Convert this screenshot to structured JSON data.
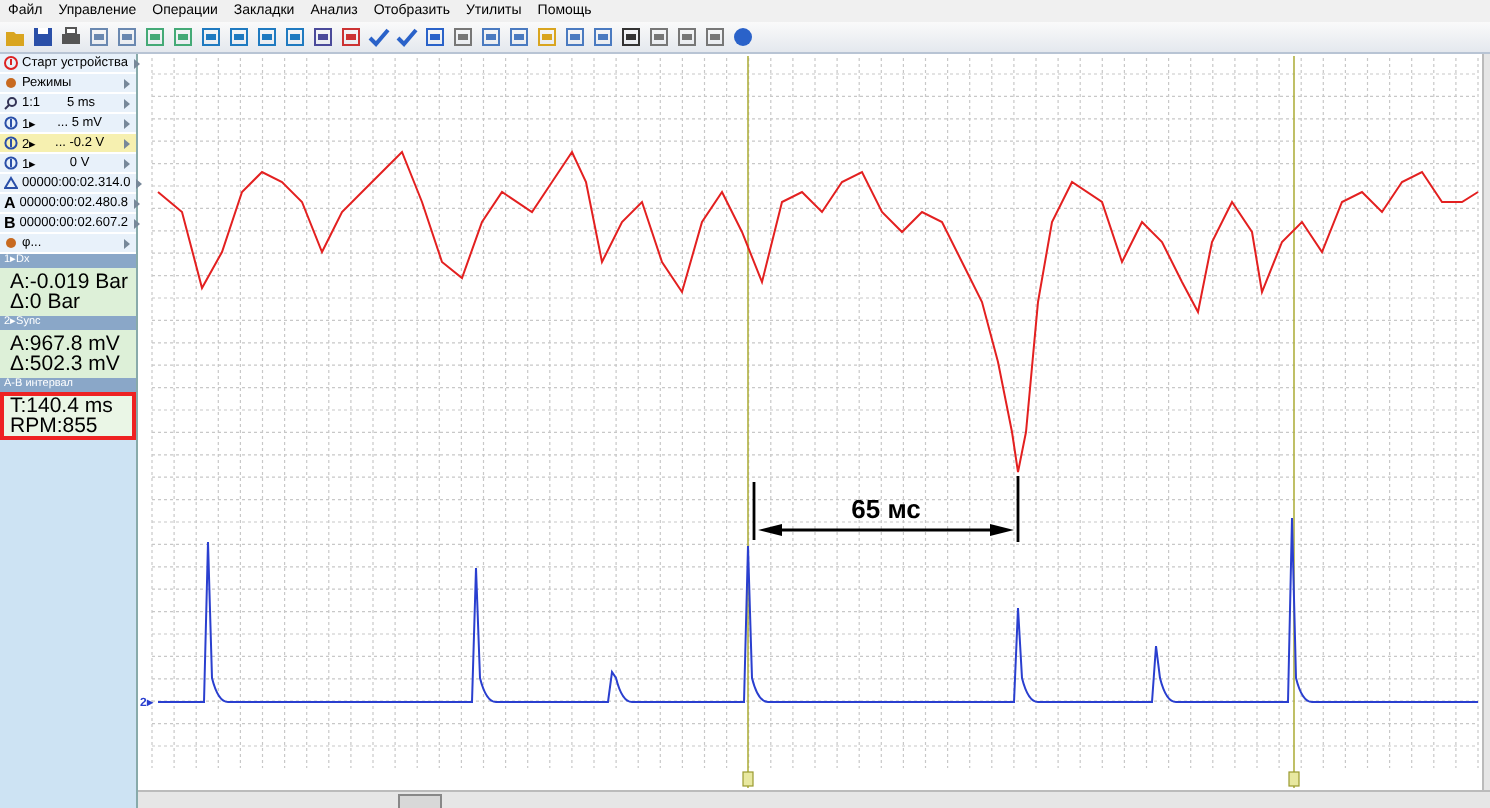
{
  "menu": [
    "Файл",
    "Управление",
    "Операции",
    "Закладки",
    "Анализ",
    "Отобразить",
    "Утилиты",
    "Помощь"
  ],
  "sidebar": {
    "items": [
      {
        "kind": "start",
        "label": "Старт устройства",
        "selected": false
      },
      {
        "kind": "menu",
        "label": "Режимы",
        "selected": false
      },
      {
        "kind": "timebase",
        "label": "1:1",
        "value": "5 ms",
        "selected": false
      },
      {
        "kind": "channel",
        "label": "1▸",
        "value": "... 5 mV",
        "selected": false
      },
      {
        "kind": "channel",
        "label": "2▸",
        "value": "... -0.2 V",
        "selected": true
      },
      {
        "kind": "trigger",
        "label": "1▸",
        "value": "0 V",
        "selected": false
      },
      {
        "kind": "delta",
        "label": "00000:00:02.314.0",
        "selected": false
      },
      {
        "kind": "cursor",
        "letter": "A",
        "label": "00000:00:02.480.8",
        "selected": false
      },
      {
        "kind": "cursor",
        "letter": "B",
        "label": "00000:00:02.607.2",
        "selected": false
      },
      {
        "kind": "menu",
        "label": "φ...",
        "selected": false
      }
    ],
    "readouts": [
      {
        "title": "1▸Dx",
        "lines": [
          "A:-0.019 Bar",
          "Δ:0 Bar"
        ],
        "highlighted": false
      },
      {
        "title": "2▸Sync",
        "lines": [
          "A:967.8 mV",
          "Δ:502.3 mV"
        ],
        "highlighted": false
      },
      {
        "title": "A-B интервал",
        "lines": [
          "T:140.4 ms",
          "RPM:855"
        ],
        "highlighted": true
      }
    ]
  },
  "chart": {
    "channel_label": "2▸",
    "annotation": "65 мс"
  }
}
